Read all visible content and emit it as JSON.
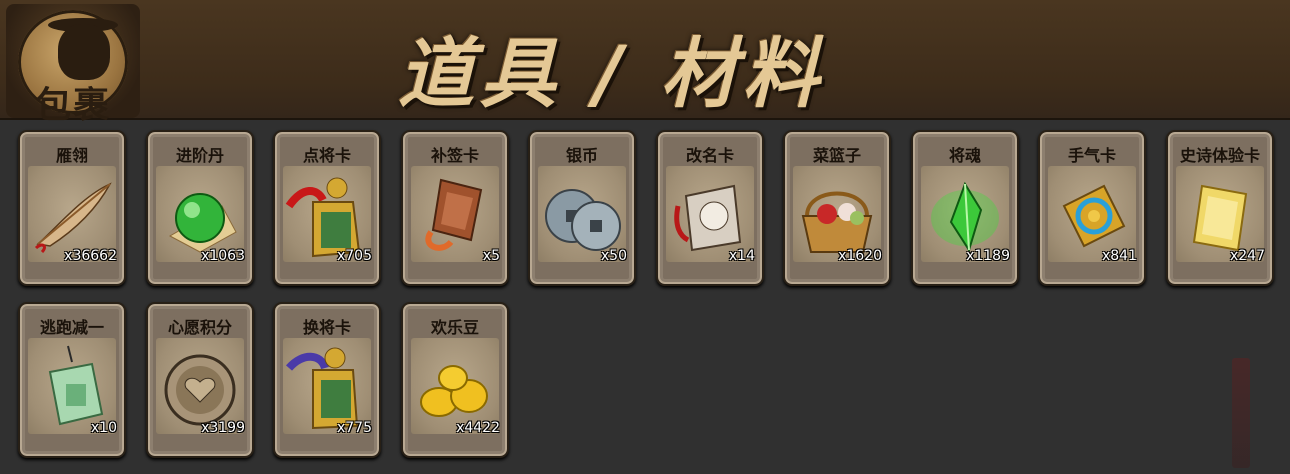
{
  "header": {
    "bag_label": "包裹",
    "title": "道具 / 材料"
  },
  "items": [
    {
      "name": "雁翎",
      "qty": "x36662",
      "icon": "feather-icon"
    },
    {
      "name": "进阶丹",
      "qty": "x1063",
      "icon": "green-pill-icon"
    },
    {
      "name": "点将卡",
      "qty": "x705",
      "icon": "jade-token-icon"
    },
    {
      "name": "补签卡",
      "qty": "x5",
      "icon": "sign-card-icon"
    },
    {
      "name": "银币",
      "qty": "x50",
      "icon": "silver-coins-icon"
    },
    {
      "name": "改名卡",
      "qty": "x14",
      "icon": "rename-card-icon"
    },
    {
      "name": "菜篮子",
      "qty": "x1620",
      "icon": "basket-icon"
    },
    {
      "name": "将魂",
      "qty": "x1189",
      "icon": "green-crystal-icon"
    },
    {
      "name": "手气卡",
      "qty": "x841",
      "icon": "luck-card-icon"
    },
    {
      "name": "史诗体验卡",
      "qty": "x247",
      "icon": "epic-card-icon"
    },
    {
      "name": "逃跑减一",
      "qty": "x10",
      "icon": "jade-tag-icon"
    },
    {
      "name": "心愿积分",
      "qty": "x3199",
      "icon": "heart-coin-icon"
    },
    {
      "name": "换将卡",
      "qty": "x775",
      "icon": "swap-token-icon"
    },
    {
      "name": "欢乐豆",
      "qty": "x4422",
      "icon": "gold-beans-icon"
    }
  ]
}
